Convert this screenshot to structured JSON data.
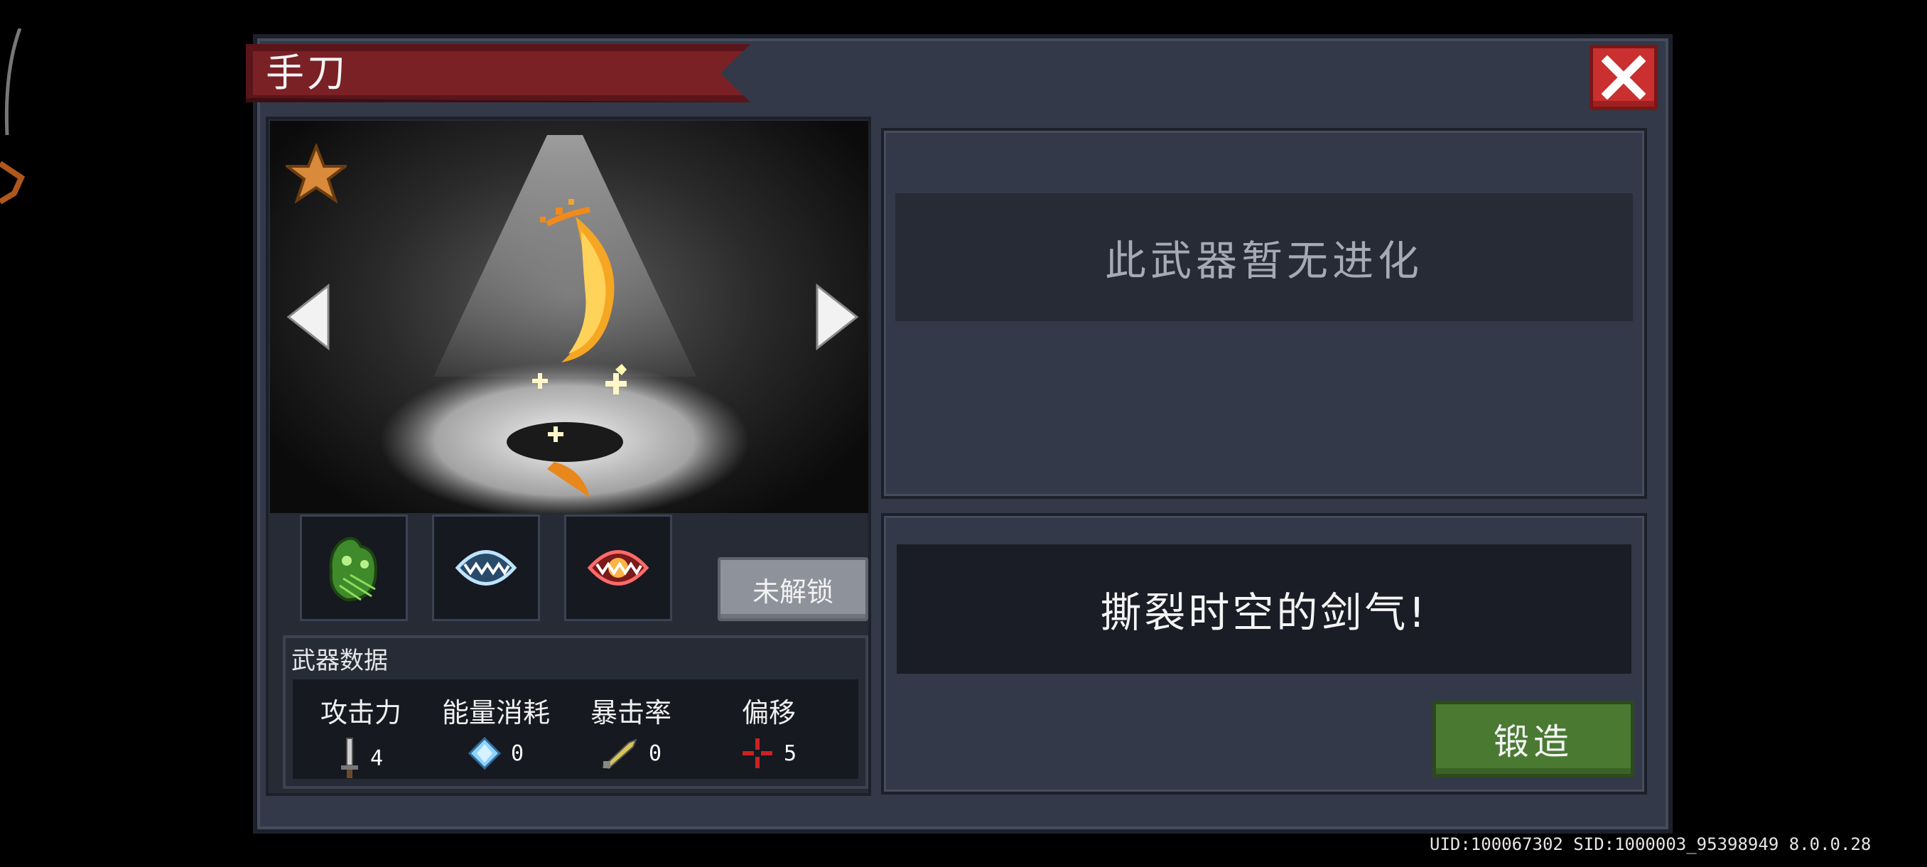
{
  "dialog": {
    "title": "手刀",
    "close_icon": "close-icon"
  },
  "weapon": {
    "evolution_text": "此武器暂无进化",
    "description": "撕裂时空的剑气!",
    "locked_label": "未解锁",
    "forge_label": "锻造"
  },
  "materials": [
    "green-slime-material-icon",
    "ice-fang-material-icon",
    "fire-fang-material-icon"
  ],
  "stats": {
    "title": "武器数据",
    "items": [
      {
        "label": "攻击力",
        "value": "4",
        "icon": "sword-icon"
      },
      {
        "label": "能量消耗",
        "value": "0",
        "icon": "energy-crystal-icon"
      },
      {
        "label": "暴击率",
        "value": "0",
        "icon": "crit-blade-icon"
      },
      {
        "label": "偏移",
        "value": "5",
        "icon": "crosshair-icon"
      }
    ]
  },
  "footer": {
    "ids": "UID:100067302 SID:1000003_95398949 8.0.0.28"
  },
  "colors": {
    "title_banner": "#7a2126",
    "close_red": "#c9302f",
    "forge_green": "#4a7a32",
    "star_orange": "#d98a3a"
  }
}
